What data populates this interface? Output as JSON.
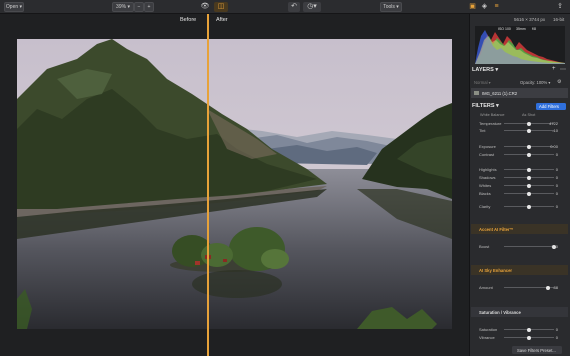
{
  "toolbar": {
    "open_label": "Open ▾",
    "zoom_label": "39% ▾",
    "zoom_minus": "−",
    "zoom_plus": "+",
    "tools_label": "Tools ▾"
  },
  "compare": {
    "before_label": "Before",
    "after_label": "After"
  },
  "panel": {
    "image_info": "5616 × 3744 px",
    "bit_depth": "16-bit",
    "histogram_stats": [
      "ISO 100",
      "35mm",
      "f/8"
    ],
    "layers_title": "LAYERS ▾",
    "opacity_label": "Opacity: 100% ▾",
    "mode_label": "Normal ▾",
    "layer_name": "IMG_6211 (1).CR2",
    "filters_title": "FILTERS ▾",
    "add_filters_label": "Add Filters",
    "white_balance_label": "White Balance",
    "white_balance_value": "As Shot",
    "rows_a": [
      {
        "label": "Temperature",
        "value": "4722"
      },
      {
        "label": "Tint",
        "value": "-10"
      }
    ],
    "rows_b": [
      {
        "label": "Exposure",
        "value": "0.00"
      },
      {
        "label": "Contrast",
        "value": "0"
      }
    ],
    "rows_c": [
      {
        "label": "Highlights",
        "value": "0"
      },
      {
        "label": "Shadows",
        "value": "0"
      },
      {
        "label": "Whites",
        "value": "0"
      },
      {
        "label": "Blacks",
        "value": "0"
      }
    ],
    "clarity_label": "Clarity",
    "clarity_value": "0",
    "accent_title": "Accent AI Filter™",
    "boost_label": "Boost",
    "boost_value": "100",
    "sky_title": "AI Sky Enhancer",
    "amount_label": "Amount",
    "amount_value": "88",
    "sat_title": "Saturation / Vibrance",
    "saturation_label": "Saturation",
    "saturation_value": "0",
    "vibrance_label": "Vibrance",
    "vibrance_value": "0",
    "save_preset_label": "Save Filters Preset..."
  },
  "colors": {
    "accent": "#e7a23a",
    "add_filters_bg": "#2f6fdc"
  },
  "slider_levels": {
    "temperature": 0.5,
    "tint": 0.5,
    "exposure": 0.5,
    "contrast": 0.5,
    "highlights": 0.5,
    "shadows": 0.5,
    "whites": 0.5,
    "blacks": 0.5,
    "clarity": 0.5,
    "boost": 1.0,
    "amount": 0.88,
    "saturation": 0.5,
    "vibrance": 0.5
  }
}
